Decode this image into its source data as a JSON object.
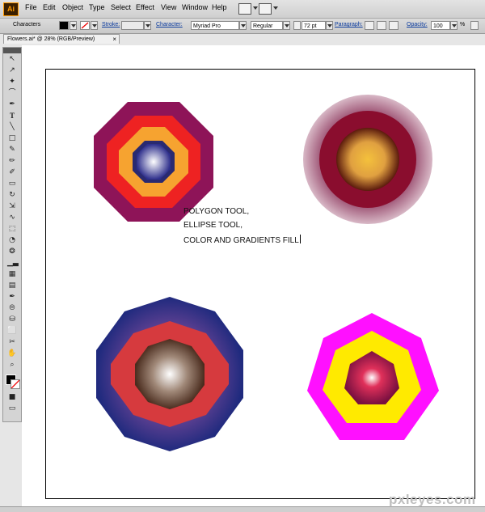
{
  "app": {
    "logo": "Ai"
  },
  "menu": [
    "File",
    "Edit",
    "Object",
    "Type",
    "Select",
    "Effect",
    "View",
    "Window",
    "Help"
  ],
  "control_bar": {
    "panel_label": "Characters",
    "stroke_label": "Stroke:",
    "character_label": "Character:",
    "font_family": "Myriad Pro",
    "font_style": "Regular",
    "font_size": "72 pt",
    "paragraph_label": "Paragraph:",
    "opacity_label": "Opacity:",
    "opacity_value": "100",
    "opacity_unit": "%"
  },
  "document_tab": {
    "title": "Flowers.ai* @ 28% (RGB/Preview)",
    "close": "×"
  },
  "caption": [
    "POLYGON TOOL,",
    "ELLIPSE TOOL,",
    "COLOR AND GRADIENTS FILL"
  ],
  "watermark": "pxleyes.com",
  "shape_colors": {
    "octagon_outer": "#8e1458",
    "octagon_red": "#ee2222",
    "octagon_orange": "#f6a330",
    "octagon_core": "#2e2f8c",
    "circle_outer": "#a0507a",
    "circle_ring": "#8a0d2e",
    "circle_core": "#f0b43a",
    "decagon_outer": "#2b2b82",
    "decagon_red": "#d63a3e",
    "decagon_core": "#4a2c1e",
    "heptagon_outer": "#ff10ff",
    "heptagon_yellow": "#ffea00",
    "heptagon_core": "#9e1448"
  }
}
